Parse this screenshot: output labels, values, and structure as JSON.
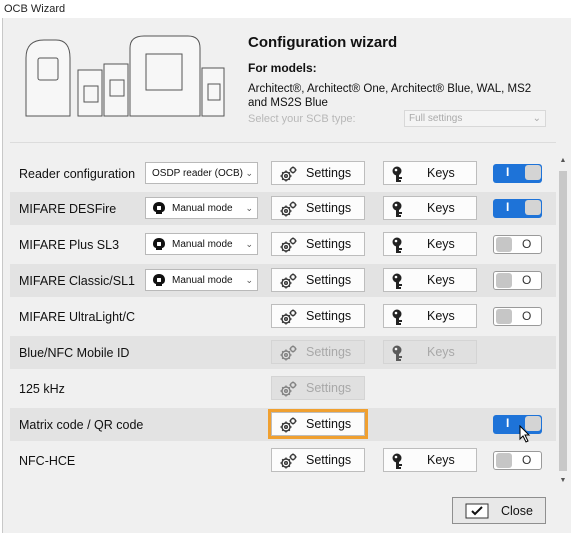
{
  "window": {
    "title": "OCB Wizard"
  },
  "header": {
    "title": "Configuration wizard",
    "for_models_label": "For models:",
    "models": "Architect®, Architect® One, Architect® Blue, WAL, MS2 and MS2S Blue",
    "scb_type_label": "Select your SCB type:",
    "scb_type_value": "Full settings"
  },
  "buttons": {
    "settings": "Settings",
    "keys": "Keys",
    "close": "Close"
  },
  "rows": [
    {
      "label": "Reader configuration",
      "combo": "OSDP reader (OCB)",
      "settings_enabled": true,
      "keys": true,
      "keys_enabled": true,
      "toggle": "on"
    },
    {
      "label": "MIFARE DESFire",
      "combo": "Manual mode",
      "settings_enabled": true,
      "keys": true,
      "keys_enabled": true,
      "toggle": "on"
    },
    {
      "label": "MIFARE Plus SL3",
      "combo": "Manual mode",
      "settings_enabled": true,
      "keys": true,
      "keys_enabled": true,
      "toggle": "off"
    },
    {
      "label": "MIFARE Classic/SL1",
      "combo": "Manual mode",
      "settings_enabled": true,
      "keys": true,
      "keys_enabled": true,
      "toggle": "off"
    },
    {
      "label": "MIFARE UltraLight/C",
      "settings_enabled": true,
      "keys": true,
      "keys_enabled": true,
      "toggle": "off"
    },
    {
      "label": "Blue/NFC Mobile ID",
      "settings_enabled": false,
      "keys": true,
      "keys_enabled": false
    },
    {
      "label": "125 kHz",
      "settings_enabled": false
    },
    {
      "label": "Matrix code / QR code",
      "settings_enabled": true,
      "highlighted": true,
      "toggle": "on"
    },
    {
      "label": "NFC-HCE",
      "settings_enabled": true,
      "keys": true,
      "keys_enabled": true,
      "toggle": "off"
    }
  ],
  "toggle_glyphs": {
    "on": "I",
    "off": "O"
  },
  "colors": {
    "accent": "#1e73d8",
    "highlight": "#f0a030",
    "alt_row": "#e3e3e3"
  },
  "icons": {
    "settings": "gears-icon",
    "keys": "key-icon",
    "mode": "lock-head-icon",
    "close": "checkmark-icon"
  }
}
